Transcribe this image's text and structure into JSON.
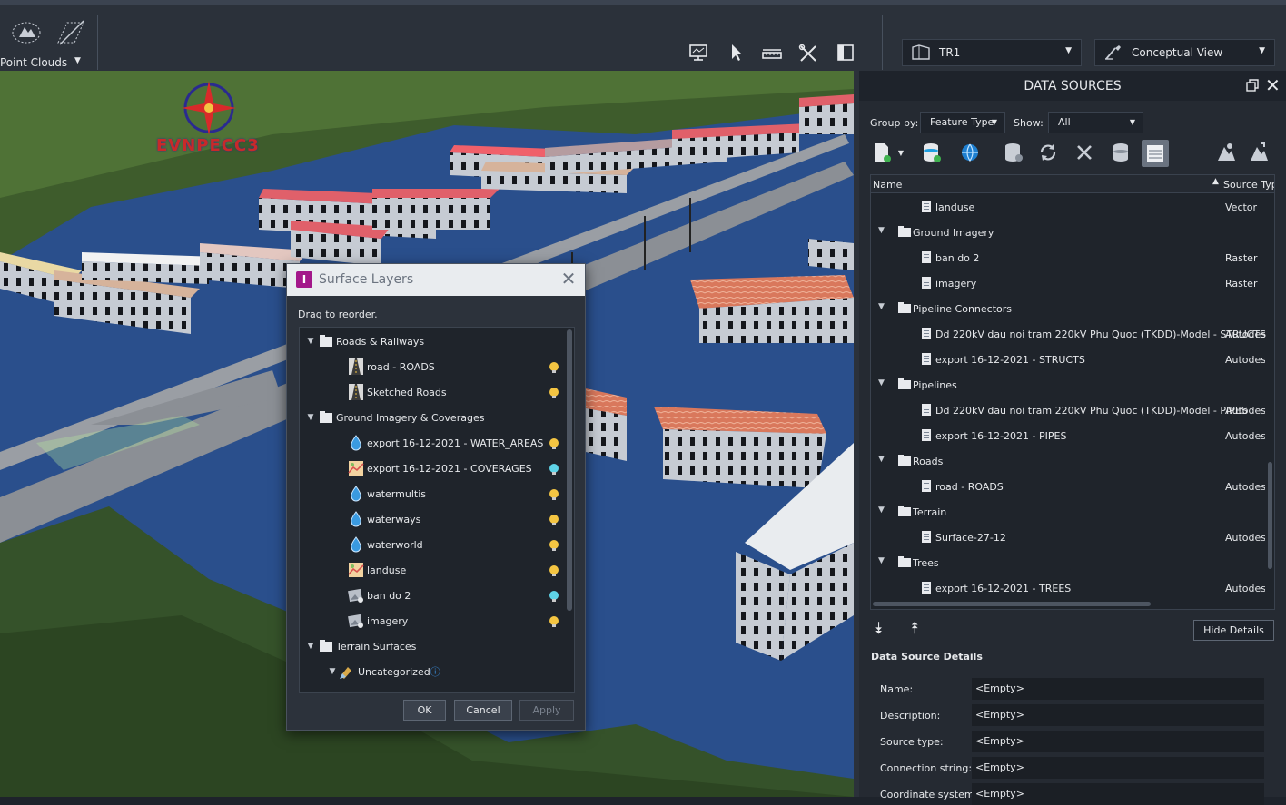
{
  "toolbar": {
    "point_clouds_label": "Point Clouds",
    "model_dropdown": "TR1",
    "view_dropdown": "Conceptual View"
  },
  "viewport": {
    "logo_text": "EVNPECC3"
  },
  "surface_layers": {
    "title": "Surface Layers",
    "hint": "Drag to reorder.",
    "rows": [
      {
        "label": "Roads & Railways",
        "kind": "group"
      },
      {
        "label": "road - ROADS",
        "kind": "road",
        "bulb": "#f4c542"
      },
      {
        "label": "Sketched Roads",
        "kind": "road",
        "bulb": "#f4c542"
      },
      {
        "label": "Ground Imagery & Coverages",
        "kind": "group"
      },
      {
        "label": "export 16-12-2021 - WATER_AREAS",
        "kind": "water",
        "bulb": "#f4c542"
      },
      {
        "label": "export 16-12-2021 - COVERAGES",
        "kind": "coverage",
        "bulb": "#5fd4e8"
      },
      {
        "label": "watermultis",
        "kind": "water",
        "bulb": "#f4c542"
      },
      {
        "label": "waterways",
        "kind": "water",
        "bulb": "#f4c542"
      },
      {
        "label": "waterworld",
        "kind": "water",
        "bulb": "#f4c542"
      },
      {
        "label": "landuse",
        "kind": "coverage",
        "bulb": "#f4c542"
      },
      {
        "label": "ban do 2",
        "kind": "imagery",
        "bulb": "#5fd4e8"
      },
      {
        "label": "imagery",
        "kind": "imagery",
        "bulb": "#f4c542"
      },
      {
        "label": "Terrain Surfaces",
        "kind": "group"
      },
      {
        "label": "Uncategorized",
        "kind": "subgroup"
      }
    ],
    "ok": "OK",
    "cancel": "Cancel",
    "apply": "Apply"
  },
  "data_sources": {
    "title": "DATA SOURCES",
    "group_by_label": "Group by:",
    "group_by_value": "Feature Type",
    "show_label": "Show:",
    "show_value": "All",
    "col_name": "Name",
    "col_source": "Source Type",
    "rows": [
      {
        "name": "landuse",
        "type": "Vector",
        "level": 1
      },
      {
        "name": "Ground Imagery",
        "type": "",
        "level": 0
      },
      {
        "name": "ban do 2",
        "type": "Raster",
        "level": 1
      },
      {
        "name": "imagery",
        "type": "Raster",
        "level": 1
      },
      {
        "name": "Pipeline Connectors",
        "type": "",
        "level": 0
      },
      {
        "name": "Dd 220kV dau noi tram 220kV Phu Quoc (TKDD)-Model - STRUCTS",
        "type": "Autodesk",
        "level": 1
      },
      {
        "name": "export 16-12-2021 - STRUCTS",
        "type": "Autodesk",
        "level": 1
      },
      {
        "name": "Pipelines",
        "type": "",
        "level": 0
      },
      {
        "name": "Dd 220kV dau noi tram 220kV Phu Quoc (TKDD)-Model - PIPES",
        "type": "Autodesk",
        "level": 1
      },
      {
        "name": "export 16-12-2021 - PIPES",
        "type": "Autodesk",
        "level": 1
      },
      {
        "name": "Roads",
        "type": "",
        "level": 0
      },
      {
        "name": "road - ROADS",
        "type": "Autodesk",
        "level": 1
      },
      {
        "name": "Terrain",
        "type": "",
        "level": 0
      },
      {
        "name": "Surface-27-12",
        "type": "Autodesk",
        "level": 1
      },
      {
        "name": "Trees",
        "type": "",
        "level": 0
      },
      {
        "name": "export 16-12-2021 - TREES",
        "type": "Autodesk",
        "level": 1
      }
    ],
    "hide_details": "Hide Details",
    "details_title": "Data Source Details",
    "details": [
      {
        "key": "Name:",
        "value": "<Empty>"
      },
      {
        "key": "Description:",
        "value": "<Empty>"
      },
      {
        "key": "Source type:",
        "value": "<Empty>"
      },
      {
        "key": "Connection string:",
        "value": "<Empty>"
      },
      {
        "key": "Coordinate system:",
        "value": "<Empty>"
      }
    ]
  }
}
